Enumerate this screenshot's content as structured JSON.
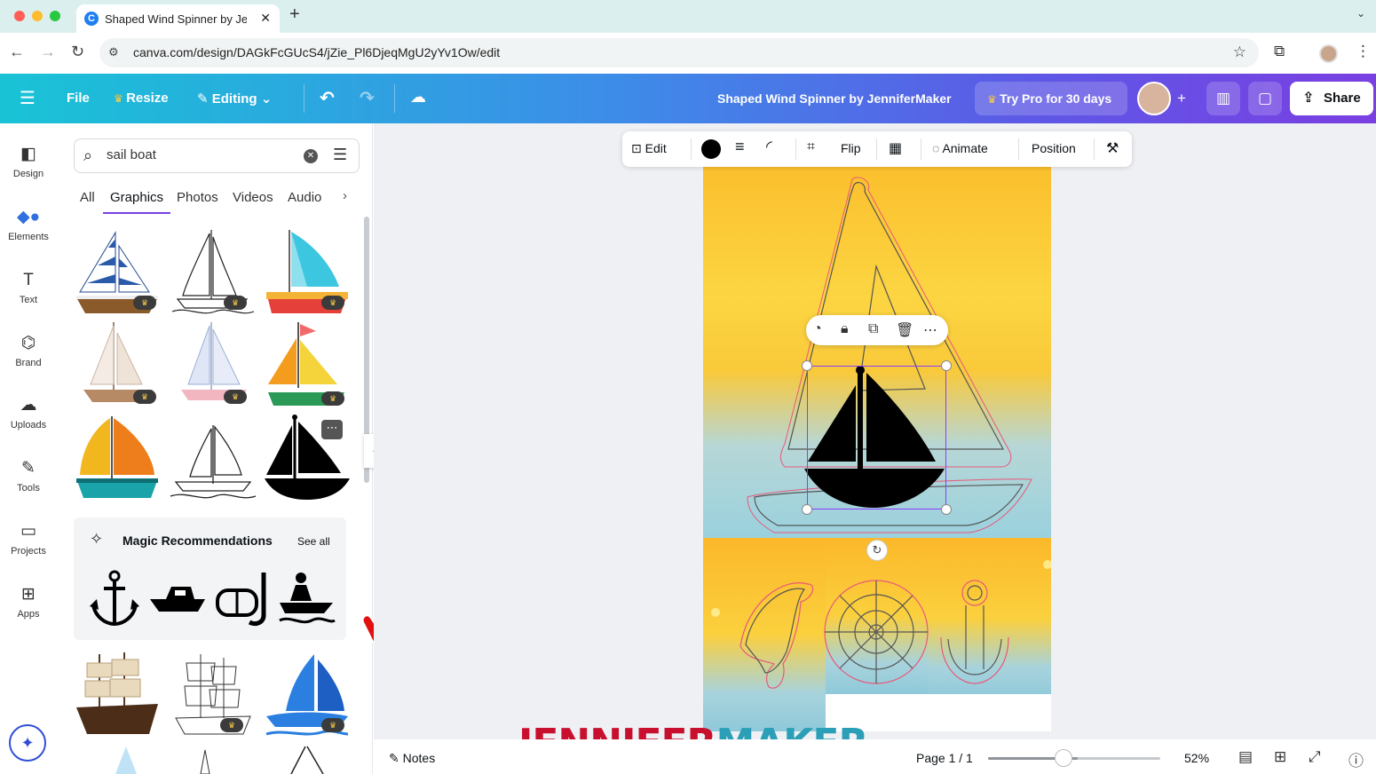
{
  "browser": {
    "tab_title": "Shaped Wind Spinner by Jenn",
    "url": "canva.com/design/DAGkFcGUcS4/jZie_Pl6DjeqMgU2yYv1Ow/edit",
    "favicon_letter": "C"
  },
  "header": {
    "file_label": "File",
    "resize_label": "Resize",
    "editing_label": "Editing",
    "doc_title": "Shaped Wind Spinner by JenniferMaker",
    "try_pro_label": "Try Pro for 30 days",
    "share_label": "Share"
  },
  "rail": {
    "items": [
      {
        "label": "Design",
        "icon": "design-icon"
      },
      {
        "label": "Elements",
        "icon": "elements-icon"
      },
      {
        "label": "Text",
        "icon": "text-icon"
      },
      {
        "label": "Brand",
        "icon": "brand-icon"
      },
      {
        "label": "Uploads",
        "icon": "uploads-icon"
      },
      {
        "label": "Tools",
        "icon": "tools-icon"
      },
      {
        "label": "Projects",
        "icon": "projects-icon"
      },
      {
        "label": "Apps",
        "icon": "apps-icon"
      }
    ]
  },
  "panel": {
    "search_value": "sail boat",
    "tabs": [
      "All",
      "Graphics",
      "Photos",
      "Videos",
      "Audio"
    ],
    "active_tab": "Graphics",
    "magic_title": "Magic Recommendations",
    "see_all": "See all"
  },
  "context_toolbar": {
    "edit": "Edit",
    "flip": "Flip",
    "animate": "Animate",
    "position": "Position"
  },
  "footer": {
    "notes": "Notes",
    "page": "Page 1 / 1",
    "zoom": "52%",
    "zoom_fraction": 0.52
  },
  "watermark": {
    "part1": "JENNIFER",
    "part2": "MAKER"
  },
  "colors": {
    "accent": "#7a3fe2",
    "header_start": "#19c3d6",
    "brand_red": "#c8102e",
    "brand_teal": "#2a9fb7"
  }
}
